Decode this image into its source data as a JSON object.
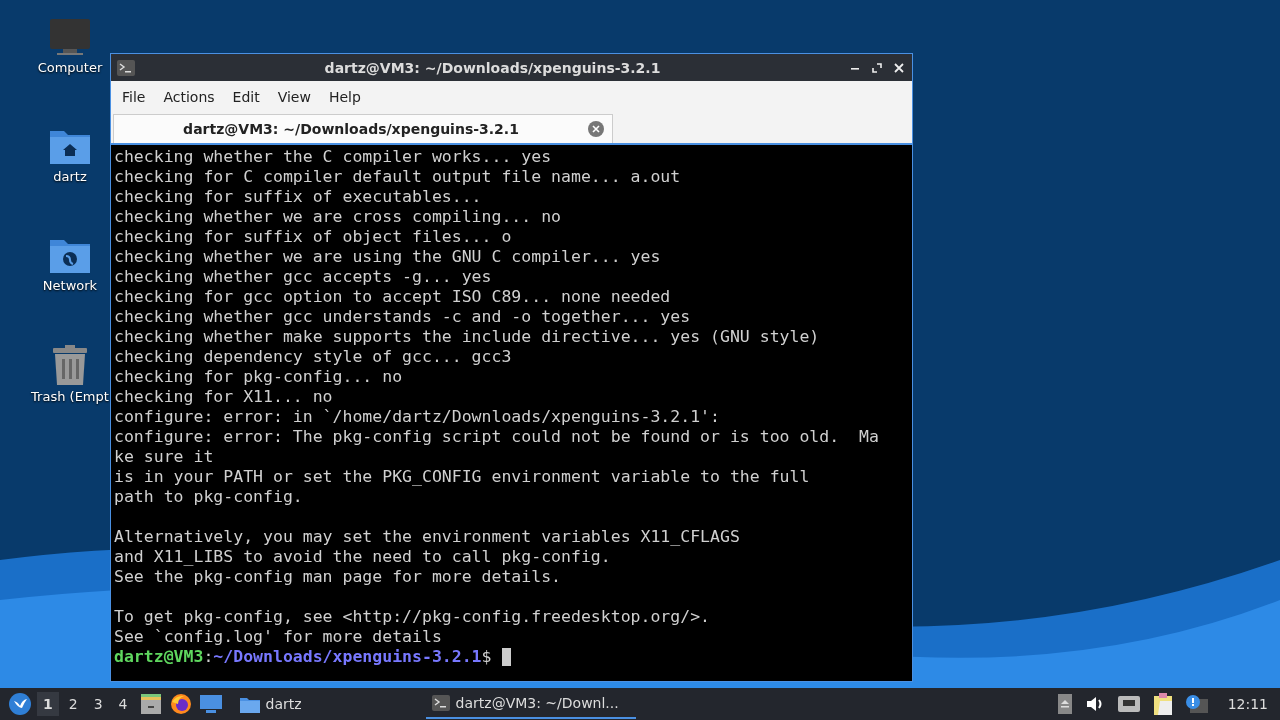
{
  "desktop_icons": [
    {
      "kind": "computer",
      "label": "Computer"
    },
    {
      "kind": "home-folder",
      "label": "dartz"
    },
    {
      "kind": "network-folder",
      "label": "Network"
    },
    {
      "kind": "trash",
      "label": "Trash (Empt"
    }
  ],
  "window": {
    "title": "dartz@VM3: ~/Downloads/xpenguins-3.2.1",
    "menu": [
      "File",
      "Actions",
      "Edit",
      "View",
      "Help"
    ],
    "tabs": [
      {
        "label": "dartz@VM3: ~/Downloads/xpenguins-3.2.1",
        "selected": true
      }
    ],
    "terminal": {
      "blocks": [
        [
          "checking whether the C compiler works... yes",
          "checking for C compiler default output file name... a.out",
          "checking for suffix of executables...",
          "checking whether we are cross compiling... no",
          "checking for suffix of object files... o",
          "checking whether we are using the GNU C compiler... yes",
          "checking whether gcc accepts -g... yes",
          "checking for gcc option to accept ISO C89... none needed",
          "checking whether gcc understands -c and -o together... yes",
          "checking whether make supports the include directive... yes (GNU style)",
          "checking dependency style of gcc... gcc3",
          "checking for pkg-config... no",
          "checking for X11... no",
          "configure: error: in `/home/dartz/Downloads/xpenguins-3.2.1':",
          "configure: error: The pkg-config script could not be found or is too old.  Ma",
          "ke sure it",
          "is in your PATH or set the PKG_CONFIG environment variable to the full",
          "path to pkg-config."
        ],
        [
          "Alternatively, you may set the environment variables X11_CFLAGS",
          "and X11_LIBS to avoid the need to call pkg-config.",
          "See the pkg-config man page for more details."
        ],
        [
          "To get pkg-config, see <http://pkg-config.freedesktop.org/>.",
          "See `config.log' for more details"
        ]
      ],
      "prompt": {
        "user": "dartz@VM3",
        "separator": ":",
        "path": "~/Downloads/xpenguins-3.2.1",
        "symbol": "$"
      }
    }
  },
  "taskbar": {
    "workspaces": [
      {
        "label": "1",
        "selected": true
      },
      {
        "label": "2",
        "selected": false
      },
      {
        "label": "3",
        "selected": false
      },
      {
        "label": "4",
        "selected": false
      }
    ],
    "launchers": [
      {
        "kind": "files"
      },
      {
        "kind": "browser"
      },
      {
        "kind": "desktop"
      }
    ],
    "folder_button": "dartz",
    "tasks": [
      {
        "label": "dartz@VM3: ~/Downl...",
        "selected": true
      }
    ],
    "tray": [
      {
        "kind": "eject"
      },
      {
        "kind": "volume"
      },
      {
        "kind": "network"
      },
      {
        "kind": "clipboard"
      },
      {
        "kind": "notification"
      }
    ],
    "clock": "12:11"
  }
}
